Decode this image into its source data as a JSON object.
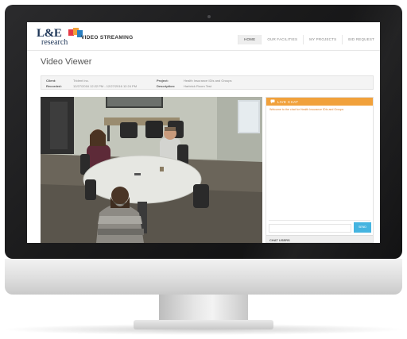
{
  "brand": {
    "logo_text": "L&E",
    "logo_subtext": "research",
    "site_name": "VIDEO STREAMING"
  },
  "nav": {
    "items": [
      {
        "label": "HOME",
        "active": true
      },
      {
        "label": "OUR FACILITIES",
        "active": false
      },
      {
        "label": "MY PROJECTS",
        "active": false
      },
      {
        "label": "BID REQUEST",
        "active": false
      }
    ]
  },
  "page": {
    "title": "Video Viewer"
  },
  "session_info": {
    "client_label": "Client:",
    "client_value": "Trident Inc.",
    "recorded_label": "Recorded:",
    "recorded_value": "12/27/2016 12:22 PM - 12/27/2016 12:24 PM",
    "project_label": "Project:",
    "project_value": "Health Insurance IDIs and Groups",
    "description_label": "Description:",
    "description_value": "Harbrick Room Test"
  },
  "chat": {
    "header": "LIVE CHAT",
    "welcome": "Welcome to the chat for Health Insurance IDIs and Groups",
    "input_value": "",
    "send_label": "SEND",
    "users_label": "CHAT USERS"
  },
  "colors": {
    "accent_orange": "#f1a13b",
    "send_blue": "#45b4e0",
    "logo_navy": "#1d3557"
  },
  "icons": {
    "chat_header": "chat-bubble-icon",
    "logo_mark": "logo-flag-icon"
  }
}
